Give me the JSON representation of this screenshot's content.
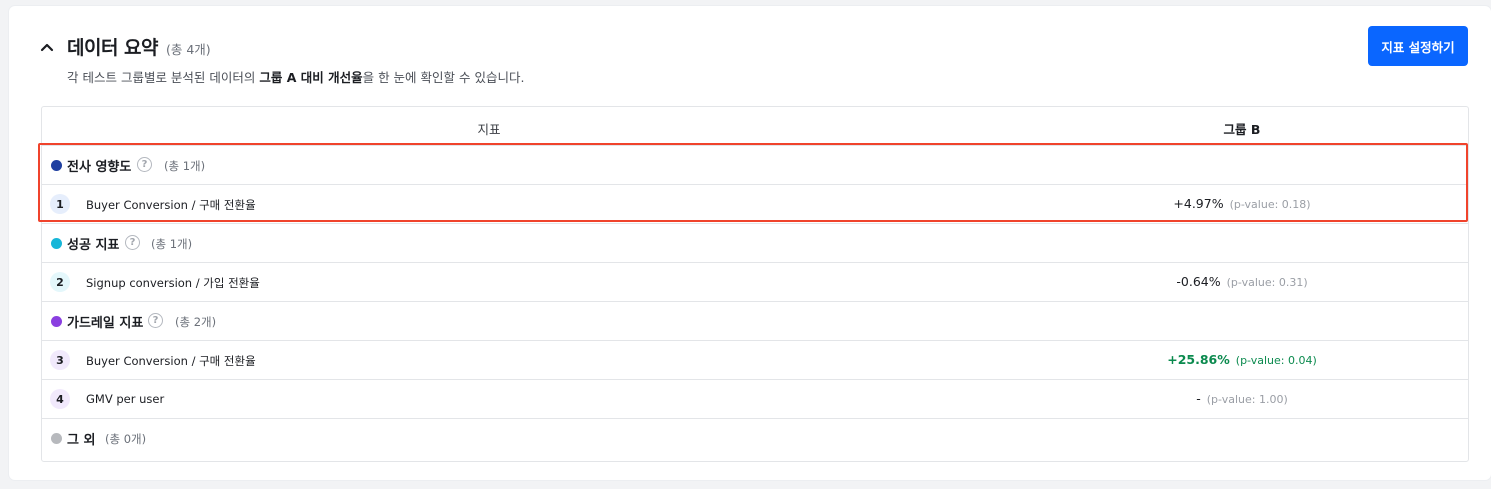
{
  "header": {
    "title": "데이터 요약",
    "count": "(총 4개)",
    "subtitle_pre": "각 테스트 그룹별로 분석된 데이터의 ",
    "subtitle_bold": "그룹 A 대비 개선율",
    "subtitle_post": "을 한 눈에 확인할 수 있습니다.",
    "setup_button": "지표 설정하기"
  },
  "table": {
    "col_metric": "지표",
    "col_group": "그룹 B"
  },
  "categories": [
    {
      "name": "전사 영향도",
      "count": "(총 1개)",
      "color": "#1f3fa0"
    },
    {
      "name": "성공 지표",
      "count": "(총 1개)",
      "color": "#17b6d8"
    },
    {
      "name": "가드레일 지표",
      "count": "(총 2개)",
      "color": "#8a3fe0"
    },
    {
      "name": "그 외",
      "count": "(총 0개)",
      "color": "#b7b9bd"
    }
  ],
  "metrics": [
    {
      "num": "1",
      "name": "Buyer Conversion / 구매 전환율",
      "value": "+4.97%",
      "pvalue": "(p-value: 0.18)",
      "badge_bg": "#e6eefc"
    },
    {
      "num": "2",
      "name": "Signup conversion / 가입 전환율",
      "value": "-0.64%",
      "pvalue": "(p-value: 0.31)",
      "badge_bg": "#e4f7fb"
    },
    {
      "num": "3",
      "name": "Buyer Conversion / 구매 전환율",
      "value": "+25.86%",
      "pvalue": "(p-value: 0.04)",
      "badge_bg": "#f1e9fc"
    },
    {
      "num": "4",
      "name": "GMV per user",
      "value": "-",
      "pvalue": "(p-value: 1.00)",
      "badge_bg": "#f1e9fc"
    }
  ],
  "icons": {
    "collapse": "chevron-up-icon",
    "help": "help-circle-icon"
  },
  "help_glyph": "?",
  "colors": {
    "accent": "#0a66ff",
    "positive": "#0b8a4e",
    "highlight": "#f0432c"
  }
}
